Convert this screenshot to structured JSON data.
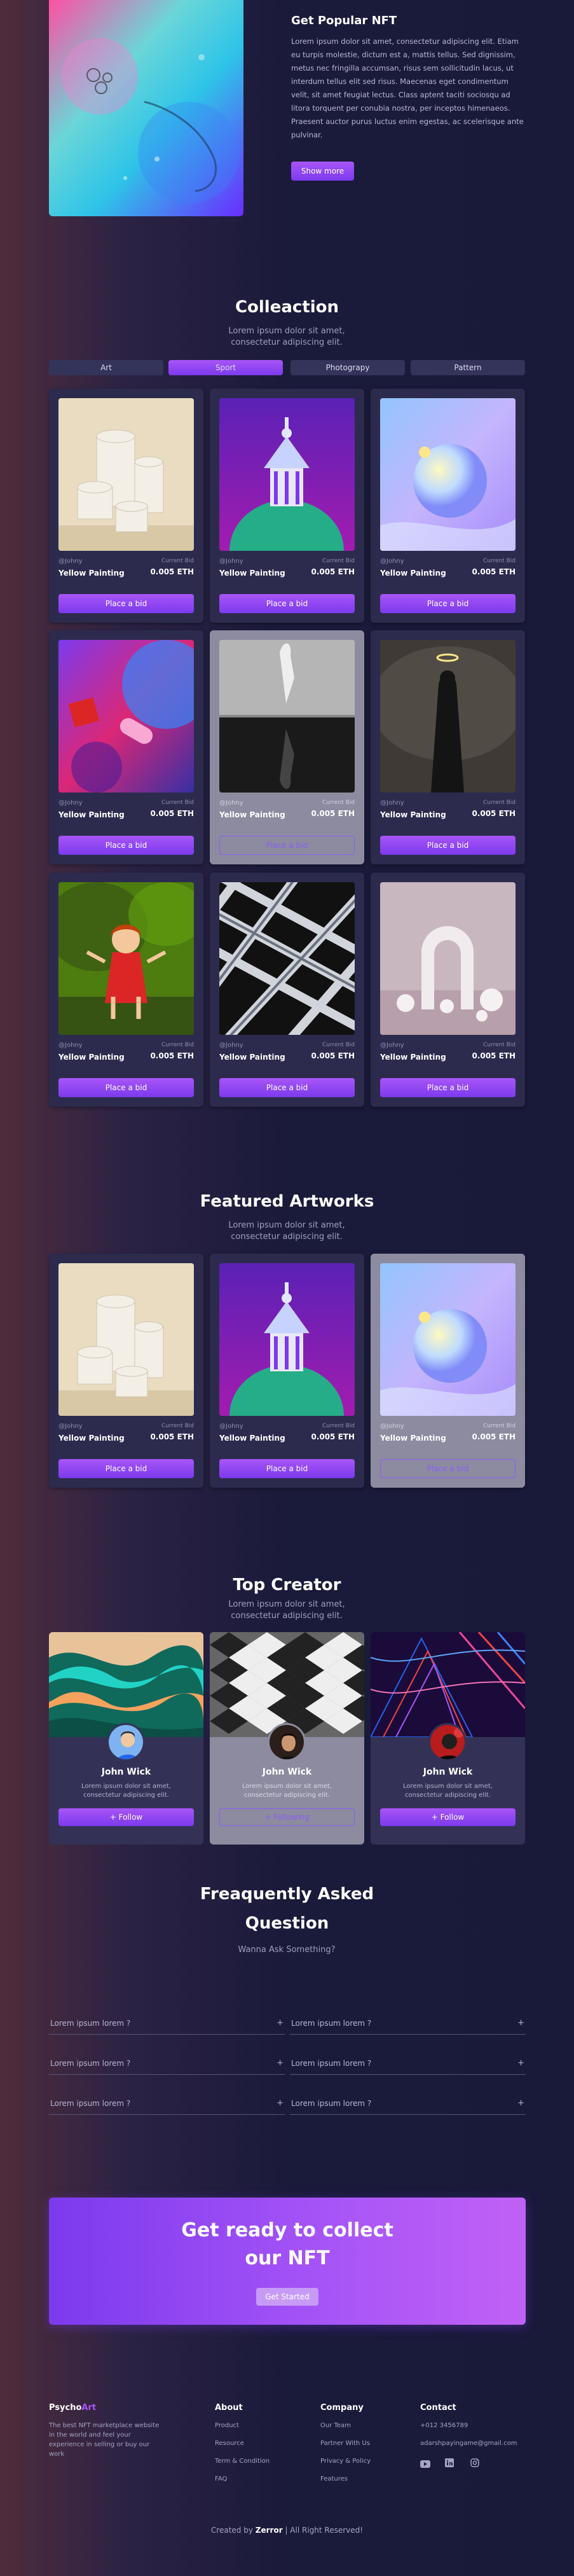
{
  "hero": {
    "title": "Get Popular NFT",
    "description": "Lorem ipsum dolor sit amet, consectetur adipiscing elit. Etiam eu turpis molestie, dictum est a, mattis tellus. Sed dignissim, metus nec fringilla accumsan, risus sem sollicitudin lacus, ut interdum tellus elit sed risus. Maecenas eget condimentum velit, sit amet feugiat lectus. Class aptent taciti sociosqu ad litora torquent per conubia nostra, per inceptos himenaeos. Praesent auctor purus luctus enim egestas, ac scelerisque ante pulvinar.",
    "button": "Show more"
  },
  "collection": {
    "title": "Colleaction",
    "subtitle": "Lorem ipsum dolor sit amet, consectetur adipiscing elit.",
    "tabs": [
      "Art",
      "Sport",
      "Photograpy",
      "Pattern"
    ],
    "active_tab": "Sport",
    "cards": [
      {
        "author": "@Johny",
        "current": "Current Bid",
        "name": "Yellow Painting",
        "price": "0.005 ETH",
        "button": "Place a bid",
        "image": "white-cylinders"
      },
      {
        "author": "@Johny",
        "current": "Current Bid",
        "name": "Yellow Painting",
        "price": "0.005 ETH",
        "button": "Place a bid",
        "image": "purple-temple"
      },
      {
        "author": "@Johny",
        "current": "Current Bid",
        "name": "Yellow Painting",
        "price": "0.005 ETH",
        "button": "Place a bid",
        "image": "holo-sphere"
      },
      {
        "author": "@Johny",
        "current": "Current Bid",
        "name": "Yellow Painting",
        "price": "0.005 ETH",
        "button": "Place a bid",
        "image": "pink-shapes"
      },
      {
        "author": "@Johny",
        "current": "Current Bid",
        "name": "Yellow Painting",
        "price": "0.005 ETH",
        "button": "Place a bid",
        "image": "hand-reflection"
      },
      {
        "author": "@Johny",
        "current": "Current Bid",
        "name": "Yellow Painting",
        "price": "0.005 ETH",
        "button": "Place a bid",
        "image": "dark-halo"
      },
      {
        "author": "@Johny",
        "current": "Current Bid",
        "name": "Yellow Painting",
        "price": "0.005 ETH",
        "button": "Place a bid",
        "image": "doll-figure"
      },
      {
        "author": "@Johny",
        "current": "Current Bid",
        "name": "Yellow Painting",
        "price": "0.005 ETH",
        "button": "Place a bid",
        "image": "weave-pattern"
      },
      {
        "author": "@Johny",
        "current": "Current Bid",
        "name": "Yellow Painting",
        "price": "0.005 ETH",
        "button": "Place a bid",
        "image": "arch-spheres"
      }
    ]
  },
  "featured": {
    "title": "Featured Artworks",
    "subtitle": "Lorem ipsum dolor sit amet, consectetur adipiscing elit.",
    "cards": [
      {
        "author": "@Johny",
        "current": "Current Bid",
        "name": "Yellow Painting",
        "price": "0.005 ETH",
        "button": "Place a bid",
        "image": "white-cylinders"
      },
      {
        "author": "@Johny",
        "current": "Current Bid",
        "name": "Yellow Painting",
        "price": "0.005 ETH",
        "button": "Place a bid",
        "image": "purple-temple"
      },
      {
        "author": "@Johny",
        "current": "Current Bid",
        "name": "Yellow Painting",
        "price": "0.005 ETH",
        "button": "Place a bid",
        "image": "holo-sphere"
      }
    ]
  },
  "creators": {
    "title": "Top Creator",
    "subtitle": "Lorem ipsum dolor sit amet, consectetur adipiscing elit.",
    "items": [
      {
        "name": "John Wick",
        "desc": "Lorem ipsum dolor sit amet, consectetur adipiscing elit.",
        "button": "+ Follow"
      },
      {
        "name": "John Wick",
        "desc": "Lorem ipsum dolor sit amet, consectetur adipiscing elit.",
        "button": "+ Following"
      },
      {
        "name": "John Wick",
        "desc": "Lorem ipsum dolor sit amet, consectetur adipiscing elit.",
        "button": "+ Follow"
      }
    ]
  },
  "faq": {
    "title_line1": "Freaquently Asked",
    "title_line2": "Question",
    "subtitle": "Wanna Ask Something?",
    "items": [
      "Lorem ipsum lorem ?",
      "Lorem ipsum lorem ?",
      "Lorem ipsum lorem ?",
      "Lorem ipsum lorem ?",
      "Lorem ipsum lorem ?",
      "Lorem ipsum lorem ?"
    ],
    "toggle": "+"
  },
  "cta": {
    "title_line1": "Get ready to collect",
    "title_line2": "our NFT",
    "button": "Get Started"
  },
  "footer": {
    "brand_part1": "Psycho",
    "brand_part2": "Art",
    "brand_desc": "The best NFT marketplace website in the world and feel your experience in selling or buy our work",
    "about": {
      "title": "About",
      "links": [
        "Product",
        "Resource",
        "Term & Condition",
        "FAQ"
      ]
    },
    "company": {
      "title": "Company",
      "links": [
        "Our Team",
        "Partner With Us",
        "Privacy & Policy",
        "Features"
      ]
    },
    "contact": {
      "title": "Contact",
      "phone": "+012 3456789",
      "email": "adarshpayingame@gmail.com"
    },
    "copyright_prefix": "Created by",
    "copyright_name": "Zerror",
    "copyright_suffix": "| All Right Reserved!"
  },
  "colors": {
    "accent": "#8b5cf6",
    "accent_dark": "#7c3aed",
    "brand_highlight": "#a855f7",
    "bg": "#1a1a3a"
  },
  "icons": [
    "youtube-icon",
    "linkedin-icon",
    "instagram-icon",
    "plus-icon"
  ]
}
